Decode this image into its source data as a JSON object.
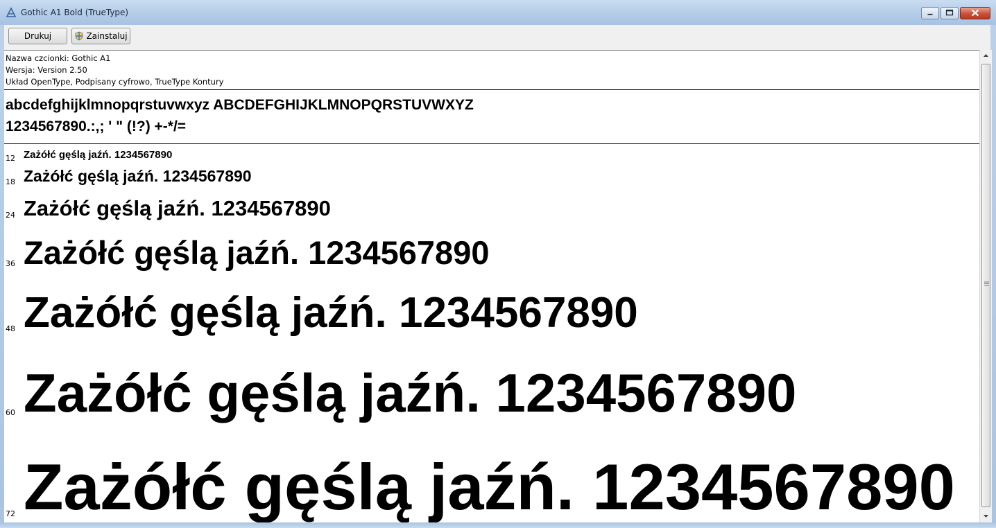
{
  "window": {
    "title": "Gothic A1 Bold (TrueType)"
  },
  "toolbar": {
    "print_label": "Drukuj",
    "install_label": "Zainstaluj"
  },
  "info": {
    "name_line": "Nazwa czcionki: Gothic A1",
    "version_line": "Wersja: Version 2.50",
    "layout_line": "Układ OpenType, Podpisany cyfrowo, TrueType Kontury"
  },
  "charset": {
    "letters": "abcdefghijklmnopqrstuvwxyz ABCDEFGHIJKLMNOPQRSTUVWXYZ",
    "digits_symbols": "1234567890.:,; ' \" (!?) +-*/="
  },
  "samples": [
    {
      "size": "12",
      "text": "Zażółć gęślą jaźń. 1234567890"
    },
    {
      "size": "18",
      "text": "Zażółć gęślą jaźń. 1234567890"
    },
    {
      "size": "24",
      "text": "Zażółć gęślą jaźń. 1234567890"
    },
    {
      "size": "36",
      "text": "Zażółć gęślą jaźń. 1234567890"
    },
    {
      "size": "48",
      "text": "Zażółć gęślą jaźń. 1234567890"
    },
    {
      "size": "60",
      "text": "Zażółć gęślą jaźń. 1234567890"
    },
    {
      "size": "72",
      "text": "Zażółć gęślą jaźń. 1234567890"
    }
  ],
  "icons": {
    "app": "font-viewer-icon",
    "minimize": "minimize-icon",
    "maximize": "maximize-icon",
    "close": "close-icon",
    "shield": "uac-shield-icon"
  }
}
